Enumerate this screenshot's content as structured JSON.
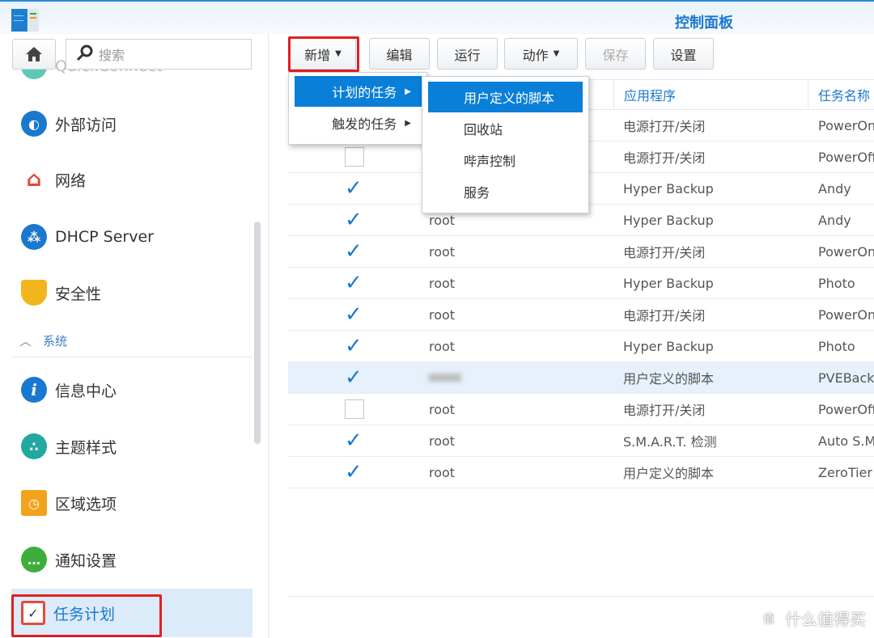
{
  "window": {
    "title": "控制面板"
  },
  "sidebar": {
    "search_placeholder": "搜索",
    "partial_item": "QuickConnect",
    "items": [
      {
        "label": "外部访问",
        "icon": "globe-icon",
        "color": "#1a78cf"
      },
      {
        "label": "网络",
        "icon": "network-house-icon",
        "color": "#e04b3a"
      },
      {
        "label": "DHCP Server",
        "icon": "dhcp-icon",
        "color": "#1a78cf"
      },
      {
        "label": "安全性",
        "icon": "shield-icon",
        "color": "#f2b51c"
      }
    ],
    "section": "系统",
    "system_items": [
      {
        "label": "信息中心",
        "icon": "info-icon",
        "color": "#1a78cf"
      },
      {
        "label": "主题样式",
        "icon": "palette-icon",
        "color": "#21a9a0"
      },
      {
        "label": "区域选项",
        "icon": "region-clock-icon",
        "color": "#f2a31c"
      },
      {
        "label": "通知设置",
        "icon": "chat-bubble-icon",
        "color": "#3cae3c"
      },
      {
        "label": "任务计划",
        "icon": "calendar-check-icon",
        "color": "#e04b3a"
      }
    ]
  },
  "toolbar": {
    "add": "新增",
    "edit": "编辑",
    "run": "运行",
    "action": "动作",
    "save": "保存",
    "settings": "设置"
  },
  "menu": {
    "items": [
      "计划的任务",
      "触发的任务"
    ],
    "submenu": [
      "用户定义的脚本",
      "回收站",
      "哔声控制",
      "服务"
    ]
  },
  "table": {
    "headers": {
      "app": "应用程序",
      "name": "任务名称"
    },
    "rows": [
      {
        "checked": true,
        "user": "",
        "app": "电源打开/关闭",
        "name": "PowerOn"
      },
      {
        "checked": false,
        "user": "",
        "app": "电源打开/关闭",
        "name": "PowerOff"
      },
      {
        "checked": true,
        "user": "",
        "app": "Hyper Backup",
        "name": "Andy"
      },
      {
        "checked": true,
        "user": "root",
        "app": "Hyper Backup",
        "name": "Andy"
      },
      {
        "checked": true,
        "user": "root",
        "app": "电源打开/关闭",
        "name": "PowerOn"
      },
      {
        "checked": true,
        "user": "root",
        "app": "Hyper Backup",
        "name": "Photo"
      },
      {
        "checked": true,
        "user": "root",
        "app": "电源打开/关闭",
        "name": "PowerOn"
      },
      {
        "checked": true,
        "user": "root",
        "app": "Hyper Backup",
        "name": "Photo"
      },
      {
        "checked": true,
        "user": "",
        "app": "用户定义的脚本",
        "name": "PVEBackup",
        "selected": true
      },
      {
        "checked": false,
        "user": "root",
        "app": "电源打开/关闭",
        "name": "PowerOff"
      },
      {
        "checked": true,
        "user": "root",
        "app": "S.M.A.R.T. 检测",
        "name": "Auto S.M.A.R.T."
      },
      {
        "checked": true,
        "user": "root",
        "app": "用户定义的脚本",
        "name": "ZeroTier"
      }
    ]
  },
  "watermark": "什么值得买"
}
